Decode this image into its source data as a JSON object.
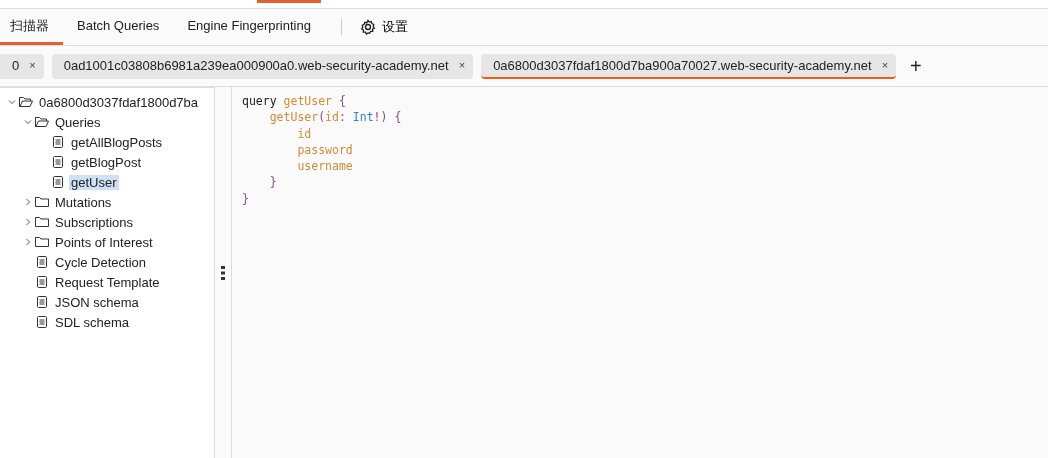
{
  "main_tabs": [
    {
      "label": "扫描器",
      "selected": true
    },
    {
      "label": "Batch Queries",
      "selected": false
    },
    {
      "label": "Engine Fingerprinting",
      "selected": false
    }
  ],
  "settings": {
    "label": "设置"
  },
  "session_tabs": [
    {
      "label": "0",
      "close": "×",
      "selected": false
    },
    {
      "label": "0ad1001c03808b6981a239ea000900a0.web-security-academy.net",
      "close": "×",
      "selected": false
    },
    {
      "label": "0a6800d3037fdaf1800d7ba900a70027.web-security-academy.net",
      "close": "×",
      "selected": true
    }
  ],
  "add_tab": "+",
  "tree": [
    {
      "kind": "folder",
      "label": "0a6800d3037fdaf1800d7ba",
      "expanded": true,
      "selected": false,
      "children": [
        {
          "kind": "folder",
          "label": "Queries",
          "expanded": true,
          "selected": false,
          "children": [
            {
              "kind": "file",
              "label": "getAllBlogPosts",
              "selected": false
            },
            {
              "kind": "file",
              "label": "getBlogPost",
              "selected": false
            },
            {
              "kind": "file",
              "label": "getUser",
              "selected": true
            }
          ]
        },
        {
          "kind": "folder",
          "label": "Mutations",
          "expanded": false,
          "selected": false
        },
        {
          "kind": "folder",
          "label": "Subscriptions",
          "expanded": false,
          "selected": false
        },
        {
          "kind": "folder",
          "label": "Points of Interest",
          "expanded": false,
          "selected": false
        },
        {
          "kind": "file",
          "label": "Cycle Detection",
          "selected": false
        },
        {
          "kind": "file",
          "label": "Request Template",
          "selected": false
        },
        {
          "kind": "file",
          "label": "JSON schema",
          "selected": false
        },
        {
          "kind": "file",
          "label": "SDL schema",
          "selected": false
        }
      ]
    }
  ],
  "code": [
    [
      {
        "kind": "keyword",
        "text": "query "
      },
      {
        "kind": "name",
        "text": "getUser "
      },
      {
        "kind": "brace",
        "text": "{"
      }
    ],
    [
      {
        "kind": "name",
        "text": "    getUser"
      },
      {
        "kind": "brace",
        "text": "("
      },
      {
        "kind": "name",
        "text": "id"
      },
      {
        "kind": "brace",
        "text": ": "
      },
      {
        "kind": "type",
        "text": "Int"
      },
      {
        "kind": "brace",
        "text": "!) {"
      }
    ],
    [
      {
        "kind": "name",
        "text": "        id"
      }
    ],
    [
      {
        "kind": "name",
        "text": "        password"
      }
    ],
    [
      {
        "kind": "name",
        "text": "        username"
      }
    ],
    [
      {
        "kind": "brace",
        "text": "    }"
      }
    ],
    [
      {
        "kind": "brace",
        "text": "}"
      }
    ]
  ]
}
